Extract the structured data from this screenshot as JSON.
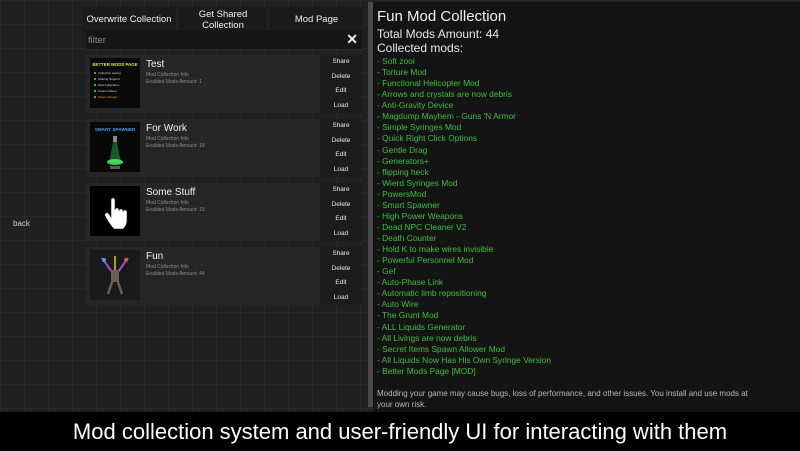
{
  "navigation": {
    "back_label": "back"
  },
  "toolbar": {
    "overwrite_label": "Overwrite Collection",
    "get_shared_label": "Get Shared Collection",
    "mod_page_label": "Mod Page"
  },
  "filter": {
    "placeholder": "filter",
    "value": "",
    "clear_icon": "close-icon"
  },
  "collections": [
    {
      "name": "Test",
      "info_label": "Mod Collection Info",
      "enabled_text": "Enabled Mods Amount: 1",
      "thumb_icon": "better-mods-page-image",
      "thumb_text": {
        "title": "BETTER MODS PAGE",
        "lines": [
          "Collection saving",
          "Sharing Support",
          "Mod Collections",
          "Custom Menu",
          "Other changes"
        ]
      },
      "actions": [
        "Share",
        "Delete",
        "Edit",
        "Load"
      ]
    },
    {
      "name": "For Work",
      "info_label": "Mod Collection Info",
      "enabled_text": "Enabled Mods Amount: 18",
      "thumb_icon": "smart-spawner-image",
      "thumb_text": {
        "title": "SMART SPAWNER"
      },
      "actions": [
        "Share",
        "Delete",
        "Edit",
        "Load"
      ]
    },
    {
      "name": "Some Stuff",
      "info_label": "Mod Collection Info",
      "enabled_text": "Enabled Mods Amount: 15",
      "thumb_icon": "hand-cursor-icon",
      "actions": [
        "Share",
        "Delete",
        "Edit",
        "Load"
      ]
    },
    {
      "name": "Fun",
      "info_label": "Mod Collection Info",
      "enabled_text": "Enabled Mods Amount: 44",
      "thumb_icon": "ragdoll-image",
      "actions": [
        "Share",
        "Delete",
        "Edit",
        "Load"
      ]
    }
  ],
  "details": {
    "title": "Fun Mod Collection",
    "total_text": "Total Mods Amount: 44",
    "collected_label": "Collected mods:",
    "mods": [
      "- Soft zooi",
      "- Torture Mod",
      "- Functional Helicopter Mod",
      "- Arrows and crystals are now debris",
      "- Anti-Gravity Device",
      "- Magdump Mayhem - Guns 'N Armor",
      "- Simple Syringes Mod",
      "- Quick Right Click Options",
      "- Gentle Drag",
      "- Generators+",
      "- flipping heck",
      "- Wierd Syringes Mod",
      "- PowersMod",
      "- Smart Spawner",
      "- High Power Weapons",
      "- Dead NPC Cleaner V2",
      "- Death Counter",
      "- Hold K to make wires invisible",
      "- Powerful Personnel Mod",
      "- Gef",
      "- Auto-Phase Link",
      "- Automatic limb repositioning",
      "- Auto Wire",
      "- The Grunt Mod",
      "- ALL Liquids Generator",
      "- All Livings are now debris",
      "- Secret Items Spawn Allower Mod",
      "- All Liquids Now Has His Own Syringe Version",
      "- Better Mods Page [MOD]"
    ],
    "disclaimer": "Modding your game may cause bugs, loss of performance, and other issues. You install and use mods at your own risk."
  },
  "caption": "Mod collection system and user-friendly UI for interacting with them",
  "colors": {
    "background": "#202020",
    "panel": "#262626",
    "mod_green": "#3fbf3f",
    "caption_bg": "#000000"
  }
}
